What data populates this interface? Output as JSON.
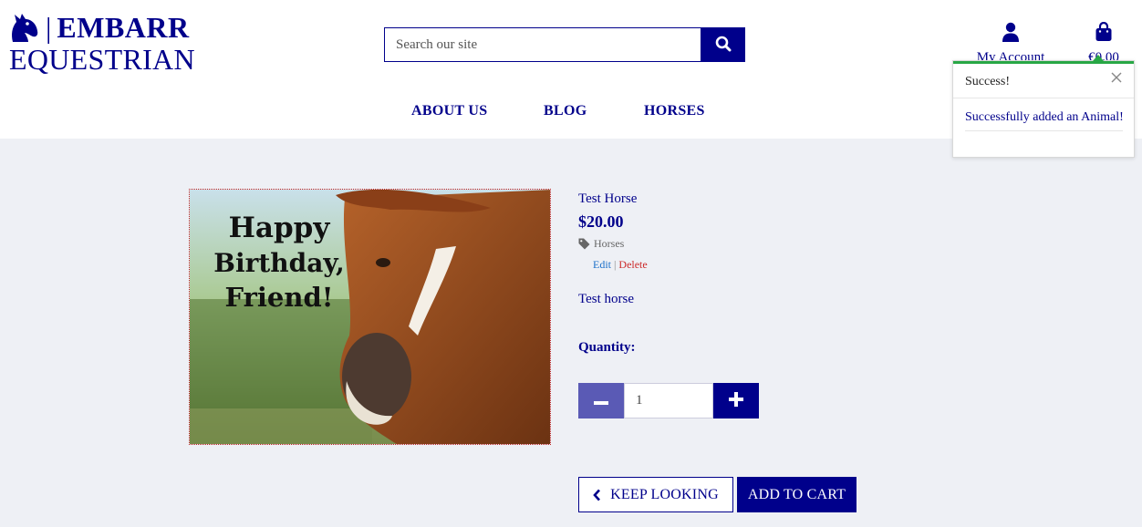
{
  "brand": {
    "separator": "|",
    "title": "EMBARR",
    "subtitle": "EQUESTRIAN",
    "icon": "horse-head-icon"
  },
  "search": {
    "placeholder": "Search our site",
    "icon": "search-icon"
  },
  "account": {
    "label": "My Account",
    "icon": "user-icon"
  },
  "bag": {
    "total": "€0.00",
    "icon": "shopping-bag-icon"
  },
  "nav": {
    "items": [
      "ABOUT US",
      "BLOG",
      "HORSES"
    ]
  },
  "toast": {
    "title": "Success!",
    "message": "Successfully added an Animal!",
    "accent_color": "#28a745"
  },
  "product": {
    "image_text": [
      "Happy",
      "Birthday,",
      "Friend!"
    ],
    "name": "Test Horse",
    "price": "$20.00",
    "category": "Horses",
    "edit_label": "Edit",
    "separator": "|",
    "delete_label": "Delete",
    "description": "Test horse",
    "quantity_label": "Quantity:",
    "quantity_value": "1"
  },
  "actions": {
    "keep_looking": "KEEP LOOKING",
    "add_to_cart": "ADD TO CART"
  },
  "colors": {
    "brand": "#00008b",
    "page_bg": "#eef0f5",
    "minus_button": "#5a5ab5",
    "delete": "#cc2b2b",
    "edit": "#1a6fc9"
  }
}
